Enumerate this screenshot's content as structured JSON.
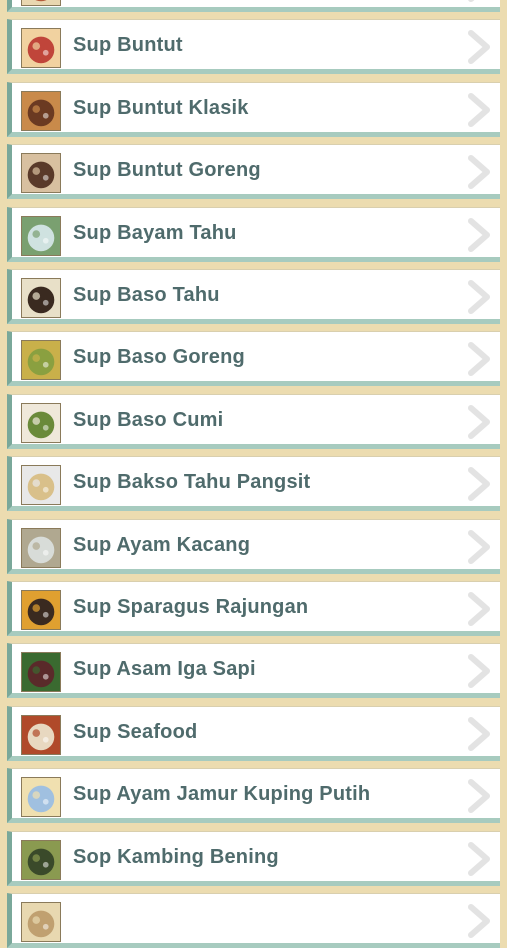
{
  "recipes": [
    {
      "label": ""
    },
    {
      "label": "Sup Buntut"
    },
    {
      "label": "Sup Buntut Klasik"
    },
    {
      "label": "Sup Buntut Goreng"
    },
    {
      "label": "Sup Bayam Tahu"
    },
    {
      "label": "Sup Baso Tahu"
    },
    {
      "label": "Sup Baso Goreng"
    },
    {
      "label": "Sup Baso Cumi"
    },
    {
      "label": "Sup Bakso Tahu Pangsit"
    },
    {
      "label": "Sup Ayam Kacang"
    },
    {
      "label": "Sup Sparagus Rajungan"
    },
    {
      "label": "Sup Asam Iga Sapi"
    },
    {
      "label": "Sup Seafood"
    },
    {
      "label": "Sup Ayam Jamur Kuping Putih"
    },
    {
      "label": "Sop Kambing Bening"
    },
    {
      "label": ""
    }
  ],
  "thumb_colors": [
    [
      "#b55a3a",
      "#e9d7b0"
    ],
    [
      "#c0453a",
      "#f1d2a0"
    ],
    [
      "#6b3a22",
      "#c98a4a"
    ],
    [
      "#5a3a2a",
      "#d8c0a0"
    ],
    [
      "#cfe2e0",
      "#7aa070"
    ],
    [
      "#3a2a20",
      "#e8e0c8"
    ],
    [
      "#8aa040",
      "#c9b04a"
    ],
    [
      "#6a8a3a",
      "#efe8da"
    ],
    [
      "#d9c08a",
      "#e8e8e8"
    ],
    [
      "#d8dcd8",
      "#b0a890"
    ],
    [
      "#3a2a20",
      "#e0a030"
    ],
    [
      "#5a2a2a",
      "#3a6a30"
    ],
    [
      "#e8d8c0",
      "#b04a2a"
    ],
    [
      "#a0c0e0",
      "#f0e0b0"
    ],
    [
      "#3a4a2a",
      "#8a9a50"
    ],
    [
      "#c0a070",
      "#e8d8b0"
    ]
  ]
}
